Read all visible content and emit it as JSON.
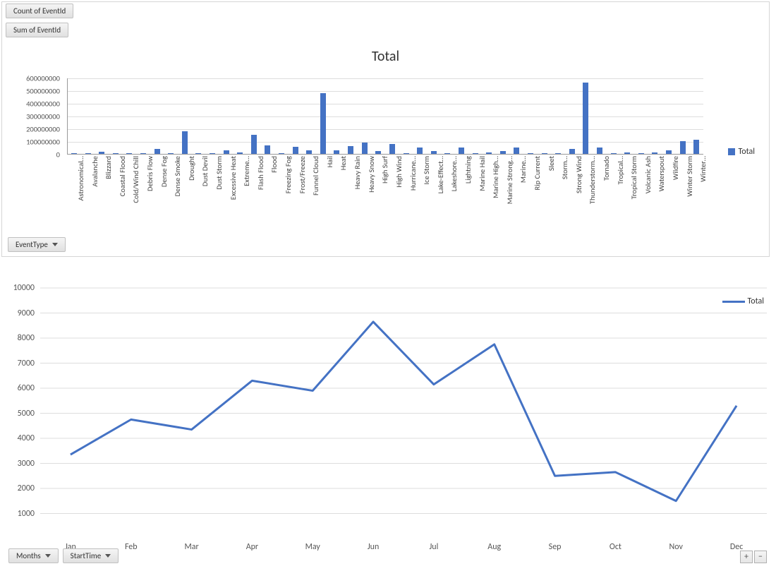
{
  "fields": {
    "count_label": "Count of EventId",
    "sum_label": "Sum of EventId",
    "eventtype_label": "EventType",
    "months_label": "Months",
    "starttime_label": "StartTime"
  },
  "legend_label": "Total",
  "zoom": {
    "plus": "+",
    "minus": "−"
  },
  "chart_data": [
    {
      "type": "bar",
      "title": "Total",
      "ylabel": "",
      "ylim": [
        0,
        600000000
      ],
      "yticks": [
        0,
        100000000,
        200000000,
        300000000,
        400000000,
        500000000,
        600000000
      ],
      "categories": [
        "Astronomical…",
        "Avalanche",
        "Blizzard",
        "Coastal Flood",
        "Cold/Wind Chill",
        "Debris Flow",
        "Dense Fog",
        "Dense Smoke",
        "Drought",
        "Dust Devil",
        "Dust Storm",
        "Excessive Heat",
        "Extreme…",
        "Flash Flood",
        "Flood",
        "Freezing Fog",
        "Frost/Freeze",
        "Funnel Cloud",
        "Hail",
        "Heat",
        "Heavy Rain",
        "Heavy Snow",
        "High Surf",
        "High Wind",
        "Hurricane…",
        "Ice Storm",
        "Lake-Effect…",
        "Lakeshore…",
        "Lightning",
        "Marine Hail",
        "Marine High…",
        "Marine Strong…",
        "Marine…",
        "Rip Current",
        "Sleet",
        "Storm…",
        "Strong Wind",
        "Thunderstorm…",
        "Tornado",
        "Tropical…",
        "Tropical Storm",
        "Volcanic Ash",
        "Waterspout",
        "Wildfire",
        "Winter Storm",
        "Winter…"
      ],
      "values": [
        2000000,
        5000000,
        15000000,
        5000000,
        5000000,
        5000000,
        40000000,
        2000000,
        180000000,
        2000000,
        2000000,
        30000000,
        10000000,
        150000000,
        65000000,
        2000000,
        55000000,
        30000000,
        480000000,
        30000000,
        60000000,
        90000000,
        20000000,
        80000000,
        2000000,
        50000000,
        20000000,
        2000000,
        50000000,
        2000000,
        10000000,
        20000000,
        50000000,
        5000000,
        5000000,
        5000000,
        40000000,
        560000000,
        50000000,
        2000000,
        10000000,
        2000000,
        10000000,
        30000000,
        100000000,
        110000000
      ]
    },
    {
      "type": "line",
      "title": "",
      "series": [
        {
          "name": "Total",
          "values": [
            3350,
            4750,
            4350,
            6300,
            5900,
            8650,
            6150,
            7750,
            2500,
            2650,
            1500,
            5300
          ]
        }
      ],
      "categories": [
        "Jan",
        "Feb",
        "Mar",
        "Apr",
        "May",
        "Jun",
        "Jul",
        "Aug",
        "Sep",
        "Oct",
        "Nov",
        "Dec"
      ],
      "ylim": [
        0,
        10000
      ],
      "yticks": [
        1000,
        2000,
        3000,
        4000,
        5000,
        6000,
        7000,
        8000,
        9000,
        10000
      ]
    }
  ]
}
